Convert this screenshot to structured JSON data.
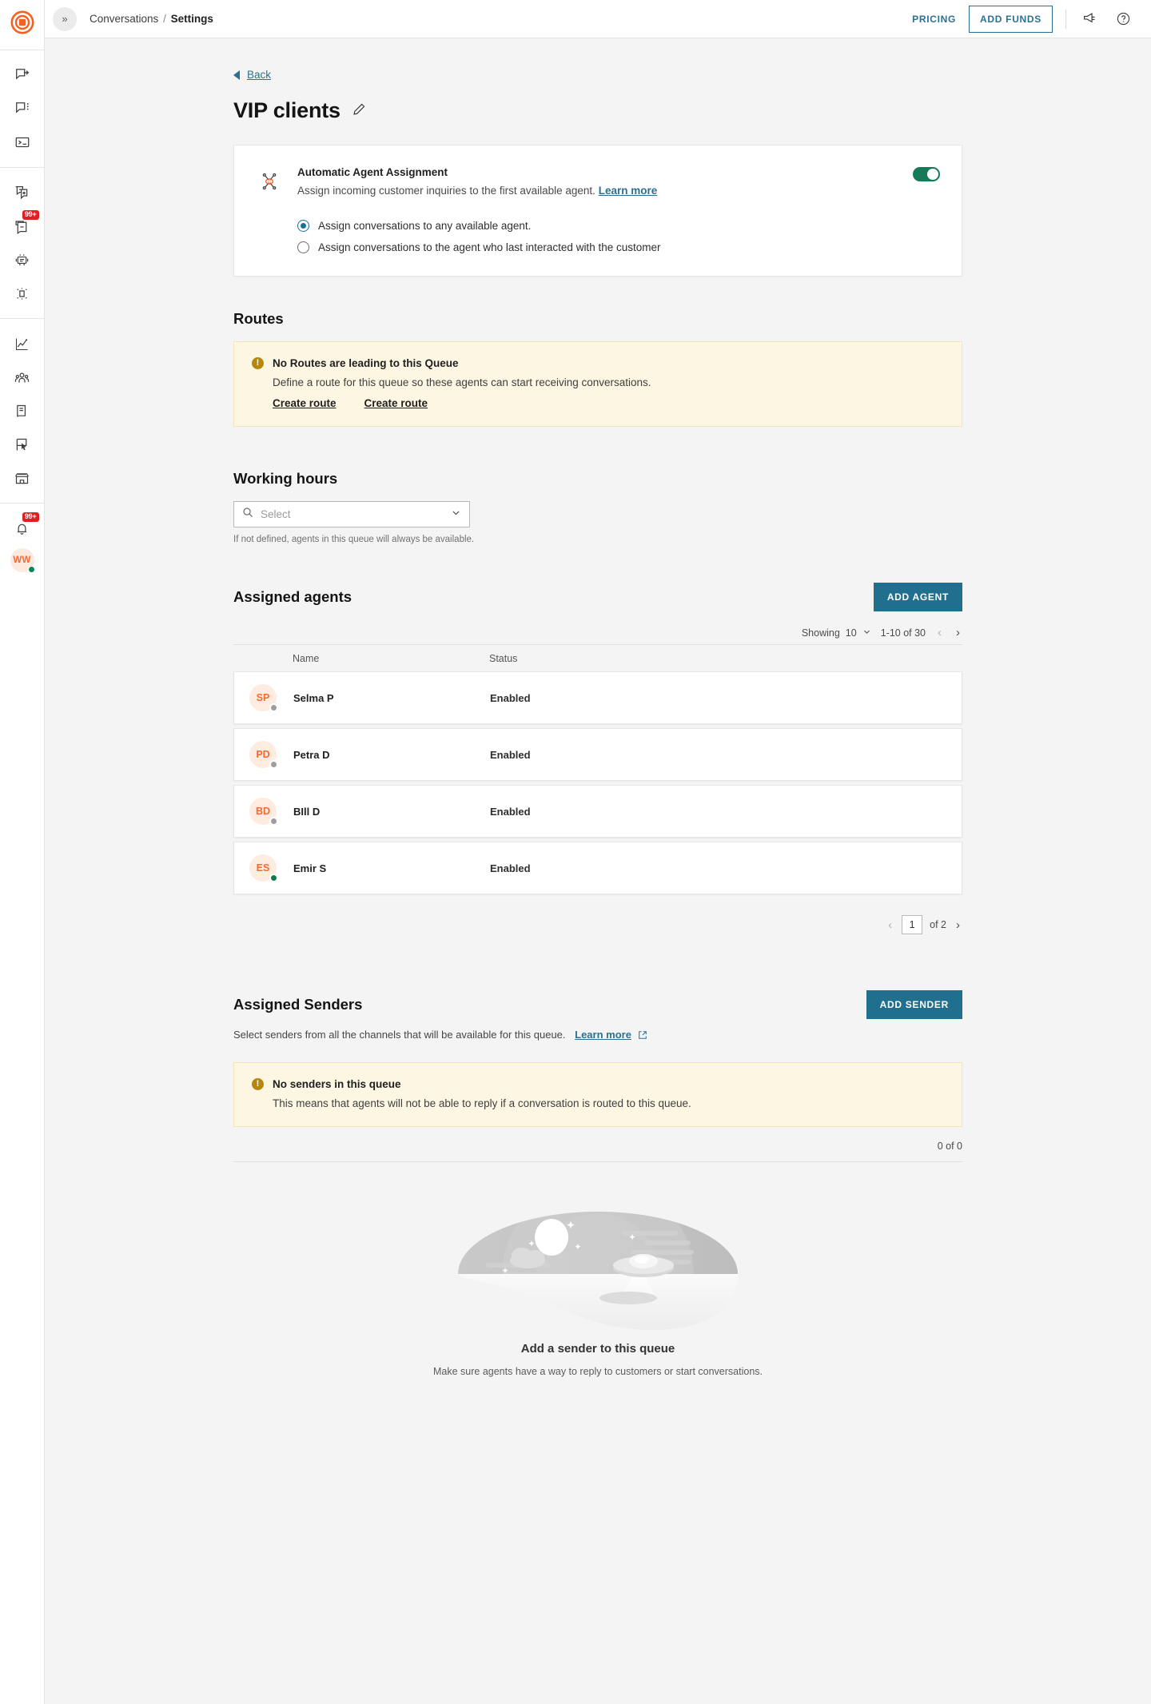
{
  "rail": {
    "logo_icon": "brand-target-logo",
    "groups": [
      {
        "items": [
          {
            "icon": "conversation-forward-icon",
            "badge": ""
          },
          {
            "icon": "conversation-more-icon",
            "badge": ""
          },
          {
            "icon": "terminal-icon",
            "badge": ""
          }
        ]
      },
      {
        "items": [
          {
            "icon": "copy-conversation-icon",
            "badge": ""
          },
          {
            "icon": "inbox-archive-icon",
            "badge": "99+"
          },
          {
            "icon": "robot-icon",
            "badge": ""
          },
          {
            "icon": "sparkle-box-icon",
            "badge": ""
          }
        ]
      },
      {
        "items": [
          {
            "icon": "analytics-chart-icon",
            "badge": ""
          },
          {
            "icon": "contacts-group-icon",
            "badge": ""
          },
          {
            "icon": "book-icon",
            "badge": ""
          },
          {
            "icon": "flag-cursor-icon",
            "badge": ""
          },
          {
            "icon": "storefront-icon",
            "badge": ""
          }
        ]
      },
      {
        "items": [
          {
            "icon": "bell-notification-icon",
            "badge": "99+"
          }
        ]
      }
    ],
    "user_initials": "WW"
  },
  "topbar": {
    "collapse_icon": "chevron-double-right-icon",
    "breadcrumb_root": "Conversations",
    "breadcrumb_sep": "/",
    "breadcrumb_current": "Settings",
    "pricing_label": "PRICING",
    "add_funds_label": "ADD FUNDS",
    "megaphone_icon": "megaphone-icon",
    "help_icon": "help-circle-icon"
  },
  "page": {
    "back_label": "Back",
    "back_icon": "back-triangle-icon",
    "title": "VIP clients",
    "edit_icon": "pencil-edit-icon"
  },
  "auto_assign": {
    "icon": "agent-routing-icon",
    "title": "Automatic Agent Assignment",
    "description": "Assign incoming customer inquiries to the first available agent.",
    "learn_more": "Learn more",
    "toggle_on": true,
    "toggle_color": "#147a58",
    "options": [
      {
        "label": "Assign conversations to any available agent.",
        "selected": true
      },
      {
        "label": "Assign conversations to the agent who last interacted with the customer",
        "selected": false
      }
    ]
  },
  "routes": {
    "heading": "Routes",
    "warning_icon": "exclamation-circle-icon",
    "warning_title": "No Routes are leading to this Queue",
    "warning_body": "Define a route for this queue so these agents can start receiving conversations.",
    "links": [
      "Create route",
      "Create route"
    ]
  },
  "working_hours": {
    "heading": "Working hours",
    "search_icon": "search-icon",
    "chevron_icon": "chevron-down-icon",
    "placeholder": "Select",
    "value": "",
    "note": "If not defined, agents in this queue will always be available."
  },
  "assigned_agents": {
    "heading": "Assigned agents",
    "add_button": "ADD AGENT",
    "showing_label": "Showing",
    "page_size": "10",
    "range_label": "1-10 of 30",
    "prev_icon": "chevron-left-icon",
    "next_icon": "chevron-right-icon",
    "columns": [
      "Name",
      "Status"
    ],
    "rows": [
      {
        "initials": "SP",
        "name": "Selma P",
        "status": "Enabled",
        "presence": "offline",
        "presence_color": "#9e9e9e"
      },
      {
        "initials": "PD",
        "name": "Petra D",
        "status": "Enabled",
        "presence": "offline",
        "presence_color": "#9e9e9e"
      },
      {
        "initials": "BD",
        "name": "BIll D",
        "status": "Enabled",
        "presence": "offline",
        "presence_color": "#9e9e9e"
      },
      {
        "initials": "ES",
        "name": "Emir S",
        "status": "Enabled",
        "presence": "online",
        "presence_color": "#0a7d4f"
      }
    ],
    "page_number": "1",
    "page_total_label": "of 2"
  },
  "assigned_senders": {
    "heading": "Assigned Senders",
    "add_button": "ADD SENDER",
    "description": "Select senders from all the channels that will be available for this queue.",
    "learn_more": "Learn more",
    "external_icon": "external-link-icon",
    "warning_icon": "exclamation-circle-icon",
    "warning_title": "No senders in this queue",
    "warning_body": "This means that agents will not be able to reply if a conversation is routed to this queue.",
    "count_label": "0 of 0",
    "empty_illustration": "ufo-night-sky-illustration",
    "empty_title": "Add a sender to this queue",
    "empty_subtitle": "Make sure agents have a way to reply to customers or start conversations."
  },
  "colors": {
    "brand_orange": "#f4601f",
    "accent_teal": "#216f8e",
    "warning_bg": "#fdf6e3",
    "warning_icon": "#b8860b",
    "toggle_green": "#147a58"
  }
}
